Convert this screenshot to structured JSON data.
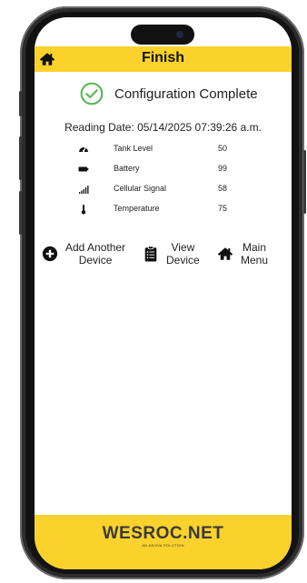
{
  "header": {
    "title": "Finish",
    "home_icon": "home-icon"
  },
  "status": {
    "text": "Configuration Complete",
    "icon": "check-circle-icon",
    "color": "#5cb85c"
  },
  "reading_date": "Reading Date: 05/14/2025 07:39:26 a.m.",
  "metrics": [
    {
      "label": "Tank Level",
      "value": "50",
      "icon": "gauge-icon"
    },
    {
      "label": "Battery",
      "value": "99",
      "icon": "battery-icon"
    },
    {
      "label": "Cellular Signal",
      "value": "58",
      "icon": "signal-icon"
    },
    {
      "label": "Temperature",
      "value": "75",
      "icon": "thermometer-icon"
    }
  ],
  "actions": [
    {
      "line1": "Add Another",
      "line2": "Device",
      "icon": "plus-circle-icon"
    },
    {
      "line1": "View",
      "line2": "Device",
      "icon": "clipboard-list-icon"
    },
    {
      "line1": "Main",
      "line2": "Menu",
      "icon": "home-icon"
    }
  ],
  "footer": {
    "brand": "WESROC.NET",
    "tagline": "AN ANOVA SOLUTION"
  },
  "colors": {
    "accent": "#fbd22c",
    "success": "#5cb85c"
  }
}
